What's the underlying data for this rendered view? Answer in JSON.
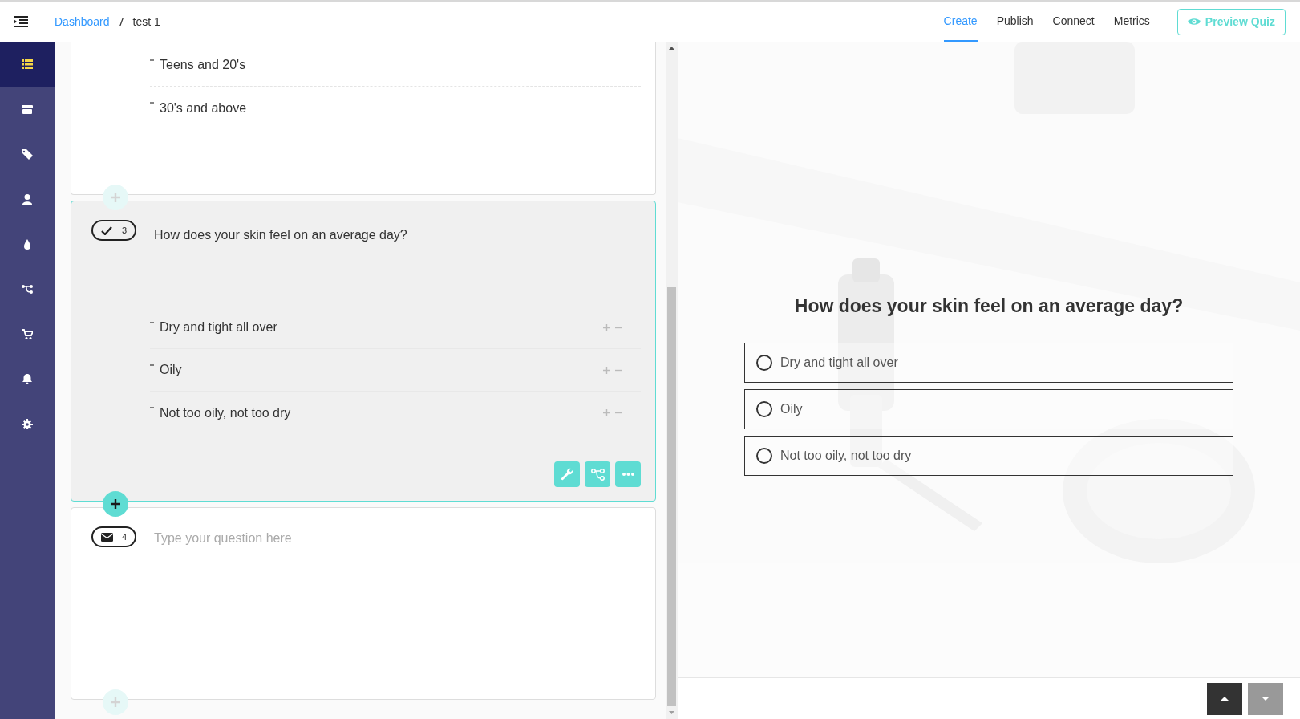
{
  "header": {
    "breadcrumb": [
      {
        "label": "Dashboard",
        "kind": "link"
      },
      {
        "label": "test 1",
        "kind": "current"
      }
    ],
    "tabs": [
      {
        "label": "Create",
        "selected": true
      },
      {
        "label": "Publish",
        "selected": false
      },
      {
        "label": "Connect",
        "selected": false
      },
      {
        "label": "Metrics",
        "selected": false
      }
    ],
    "preview_button": "Preview Quiz"
  },
  "sidebar": {
    "items": [
      {
        "kind": "list",
        "selected": true
      },
      {
        "kind": "box",
        "selected": false
      },
      {
        "kind": "tag",
        "selected": false
      },
      {
        "kind": "user",
        "selected": false
      },
      {
        "kind": "drop",
        "selected": false
      },
      {
        "kind": "flow",
        "selected": false
      },
      {
        "kind": "cart",
        "selected": false
      },
      {
        "kind": "bell",
        "selected": false
      },
      {
        "kind": "gear",
        "selected": false
      }
    ]
  },
  "editor": {
    "questions": [
      {
        "kind": "cut",
        "active": false,
        "options": [
          "Teens and 20's",
          "30's and above"
        ]
      },
      {
        "kind": "choice",
        "active": true,
        "number": "3",
        "text": "How does your skin feel on an average day?",
        "options": [
          "Dry and tight all over",
          "Oily",
          "Not too oily, not too dry"
        ]
      },
      {
        "kind": "email",
        "active": false,
        "number": "4",
        "placeholder": "Type your question here"
      }
    ],
    "add_buttons": [
      {
        "active": false
      },
      {
        "active": true
      },
      {
        "active": false
      }
    ]
  },
  "preview": {
    "question": "How does your skin feel on an average day?",
    "options": [
      {
        "label": "Dry and tight all over",
        "selected": false
      },
      {
        "label": "Oily",
        "selected": false
      },
      {
        "label": "Not too oily, not too dry",
        "selected": false
      }
    ]
  }
}
